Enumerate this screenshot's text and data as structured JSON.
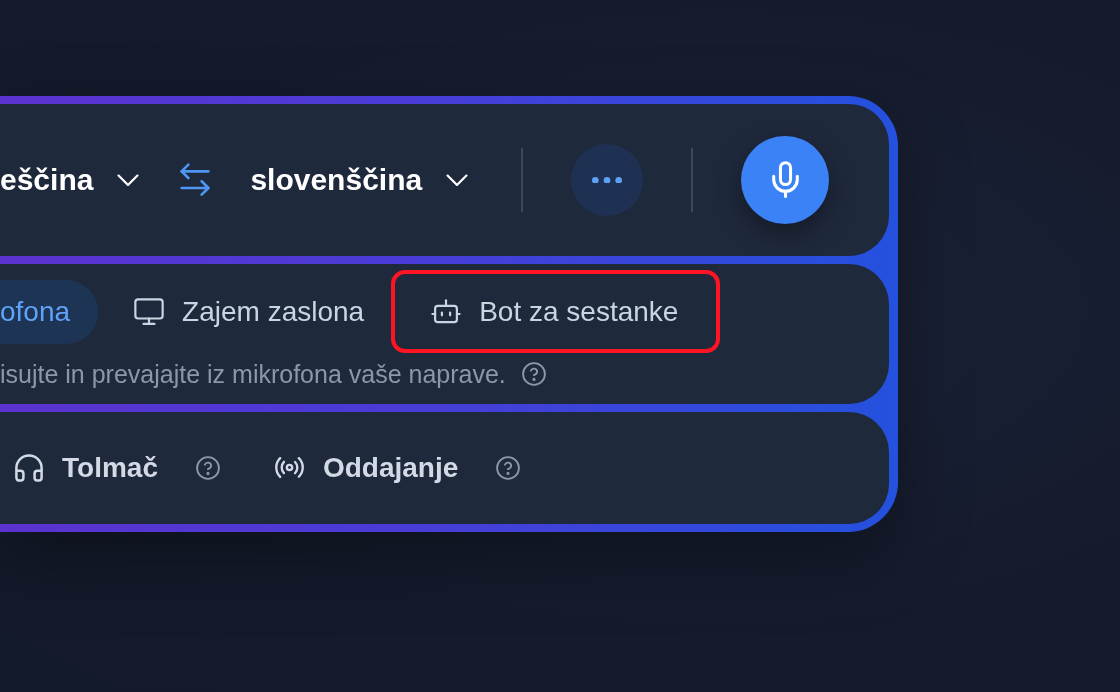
{
  "language_bar": {
    "source_language": "eščina",
    "target_language": "slovenščina"
  },
  "input_modes": {
    "tabs": [
      {
        "label": "ofona",
        "kind": "plain",
        "selected": true,
        "highlighted": false
      },
      {
        "label": "Zajem zaslona",
        "kind": "screen",
        "selected": false,
        "highlighted": false
      },
      {
        "label": "Bot za sestanke",
        "kind": "bot",
        "selected": false,
        "highlighted": true
      }
    ],
    "description": "isujte in prevajajte iz mikrofona vaše naprave."
  },
  "output_modes": [
    {
      "label": "Tolmač",
      "kind": "interpreter"
    },
    {
      "label": "Oddajanje",
      "kind": "broadcast"
    }
  ]
}
